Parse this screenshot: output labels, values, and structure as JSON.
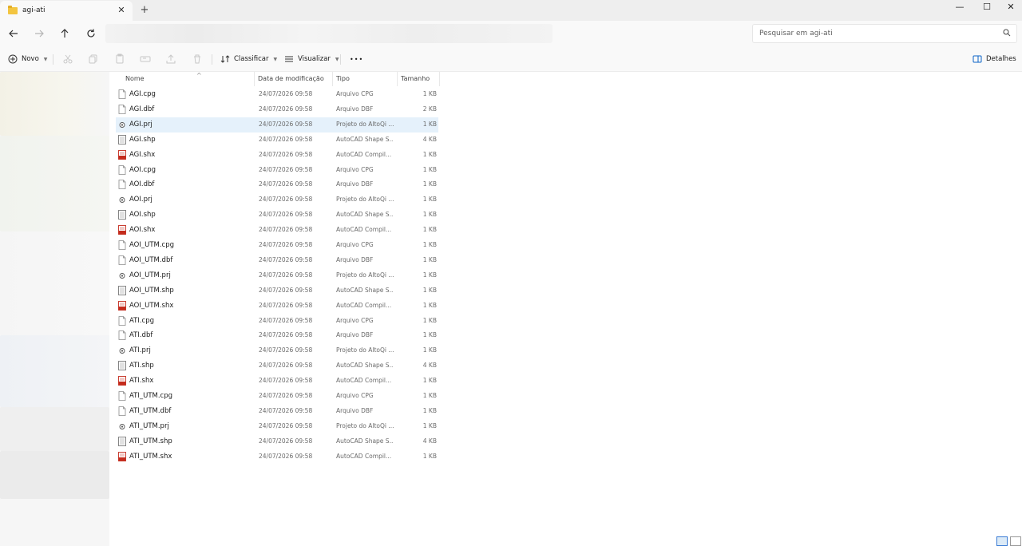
{
  "tab": {
    "title": "agi-ati",
    "close": "✕",
    "new": "+"
  },
  "window": {
    "minimize": "—",
    "maximize": "☐",
    "close": "✕"
  },
  "search": {
    "placeholder": "Pesquisar em agi-ati"
  },
  "toolbar": {
    "new_label": "Novo",
    "sort_label": "Classificar",
    "view_label": "Visualizar",
    "more_label": "•••",
    "details_label": "Detalhes"
  },
  "columns": {
    "name": "Nome",
    "date": "Data de modificação",
    "type": "Tipo",
    "size": "Tamanho"
  },
  "selected_row": 2,
  "files": [
    {
      "name": "AGI.cpg",
      "date": "24/07/2026 09:58",
      "type": "Arquivo CPG",
      "size": "1 KB",
      "icon": "file-icon"
    },
    {
      "name": "AGI.dbf",
      "date": "24/07/2026 09:58",
      "type": "Arquivo DBF",
      "size": "2 KB",
      "icon": "file-icon"
    },
    {
      "name": "AGI.prj",
      "date": "24/07/2026 09:58",
      "type": "Projeto do AltoQi ...",
      "size": "1 KB",
      "icon": "prj-icon"
    },
    {
      "name": "AGI.shp",
      "date": "24/07/2026 09:58",
      "type": "AutoCAD Shape S...",
      "size": "4 KB",
      "icon": "shp-icon"
    },
    {
      "name": "AGI.shx",
      "date": "24/07/2026 09:58",
      "type": "AutoCAD Compil...",
      "size": "1 KB",
      "icon": "shx-icon"
    },
    {
      "name": "AOI.cpg",
      "date": "24/07/2026 09:58",
      "type": "Arquivo CPG",
      "size": "1 KB",
      "icon": "file-icon"
    },
    {
      "name": "AOI.dbf",
      "date": "24/07/2026 09:58",
      "type": "Arquivo DBF",
      "size": "1 KB",
      "icon": "file-icon"
    },
    {
      "name": "AOI.prj",
      "date": "24/07/2026 09:58",
      "type": "Projeto do AltoQi ...",
      "size": "1 KB",
      "icon": "prj-icon"
    },
    {
      "name": "AOI.shp",
      "date": "24/07/2026 09:58",
      "type": "AutoCAD Shape S...",
      "size": "1 KB",
      "icon": "shp-icon"
    },
    {
      "name": "AOI.shx",
      "date": "24/07/2026 09:58",
      "type": "AutoCAD Compil...",
      "size": "1 KB",
      "icon": "shx-icon"
    },
    {
      "name": "AOI_UTM.cpg",
      "date": "24/07/2026 09:58",
      "type": "Arquivo CPG",
      "size": "1 KB",
      "icon": "file-icon"
    },
    {
      "name": "AOI_UTM.dbf",
      "date": "24/07/2026 09:58",
      "type": "Arquivo DBF",
      "size": "1 KB",
      "icon": "file-icon"
    },
    {
      "name": "AOI_UTM.prj",
      "date": "24/07/2026 09:58",
      "type": "Projeto do AltoQi ...",
      "size": "1 KB",
      "icon": "prj-icon"
    },
    {
      "name": "AOI_UTM.shp",
      "date": "24/07/2026 09:58",
      "type": "AutoCAD Shape S...",
      "size": "1 KB",
      "icon": "shp-icon"
    },
    {
      "name": "AOI_UTM.shx",
      "date": "24/07/2026 09:58",
      "type": "AutoCAD Compil...",
      "size": "1 KB",
      "icon": "shx-icon"
    },
    {
      "name": "ATI.cpg",
      "date": "24/07/2026 09:58",
      "type": "Arquivo CPG",
      "size": "1 KB",
      "icon": "file-icon"
    },
    {
      "name": "ATI.dbf",
      "date": "24/07/2026 09:58",
      "type": "Arquivo DBF",
      "size": "1 KB",
      "icon": "file-icon"
    },
    {
      "name": "ATI.prj",
      "date": "24/07/2026 09:58",
      "type": "Projeto do AltoQi ...",
      "size": "1 KB",
      "icon": "prj-icon"
    },
    {
      "name": "ATI.shp",
      "date": "24/07/2026 09:58",
      "type": "AutoCAD Shape S...",
      "size": "4 KB",
      "icon": "shp-icon"
    },
    {
      "name": "ATI.shx",
      "date": "24/07/2026 09:58",
      "type": "AutoCAD Compil...",
      "size": "1 KB",
      "icon": "shx-icon"
    },
    {
      "name": "ATI_UTM.cpg",
      "date": "24/07/2026 09:58",
      "type": "Arquivo CPG",
      "size": "1 KB",
      "icon": "file-icon"
    },
    {
      "name": "ATI_UTM.dbf",
      "date": "24/07/2026 09:58",
      "type": "Arquivo DBF",
      "size": "1 KB",
      "icon": "file-icon"
    },
    {
      "name": "ATI_UTM.prj",
      "date": "24/07/2026 09:58",
      "type": "Projeto do AltoQi ...",
      "size": "1 KB",
      "icon": "prj-icon"
    },
    {
      "name": "ATI_UTM.shp",
      "date": "24/07/2026 09:58",
      "type": "AutoCAD Shape S...",
      "size": "4 KB",
      "icon": "shp-icon"
    },
    {
      "name": "ATI_UTM.shx",
      "date": "24/07/2026 09:58",
      "type": "AutoCAD Compil...",
      "size": "1 KB",
      "icon": "shx-icon"
    }
  ],
  "colors": {
    "selection": "#e5f1fb",
    "accent": "#0a64c8",
    "shx_red": "#c42b1c"
  }
}
